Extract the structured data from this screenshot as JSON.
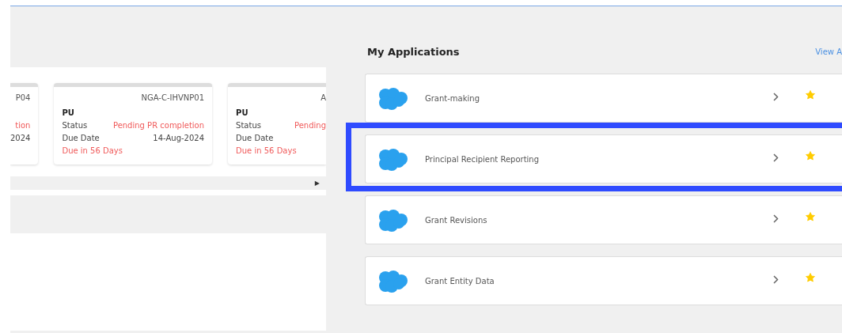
{
  "tasks": {
    "cards": [
      {
        "kind": "cut_left",
        "id": "P04",
        "status_value": "tion",
        "due_value": "2024"
      },
      {
        "kind": "full",
        "id": "NGA-C-IHVNP01",
        "title": "PU",
        "status_label": "Status",
        "status_value": "Pending PR completion",
        "due_label": "Due Date",
        "due_value": "14-Aug-2024",
        "due_in": "Due in 56 Days"
      },
      {
        "kind": "cut_right",
        "id": "A",
        "title": "PU",
        "status_label": "Status",
        "status_value": "Pending",
        "due_label": "Due Date",
        "due_in": "Due in 56 Days"
      }
    ],
    "scroll_arrow": "▶"
  },
  "applications": {
    "title": "My Applications",
    "view_all": "View A",
    "items": [
      {
        "name": "Grant-making",
        "highlighted": false,
        "favorite": true
      },
      {
        "name": "Principal Recipient Reporting",
        "highlighted": true,
        "favorite": true
      },
      {
        "name": "Grant Revisions",
        "highlighted": false,
        "favorite": true
      },
      {
        "name": "Grant Entity Data",
        "highlighted": false,
        "favorite": true
      }
    ]
  }
}
